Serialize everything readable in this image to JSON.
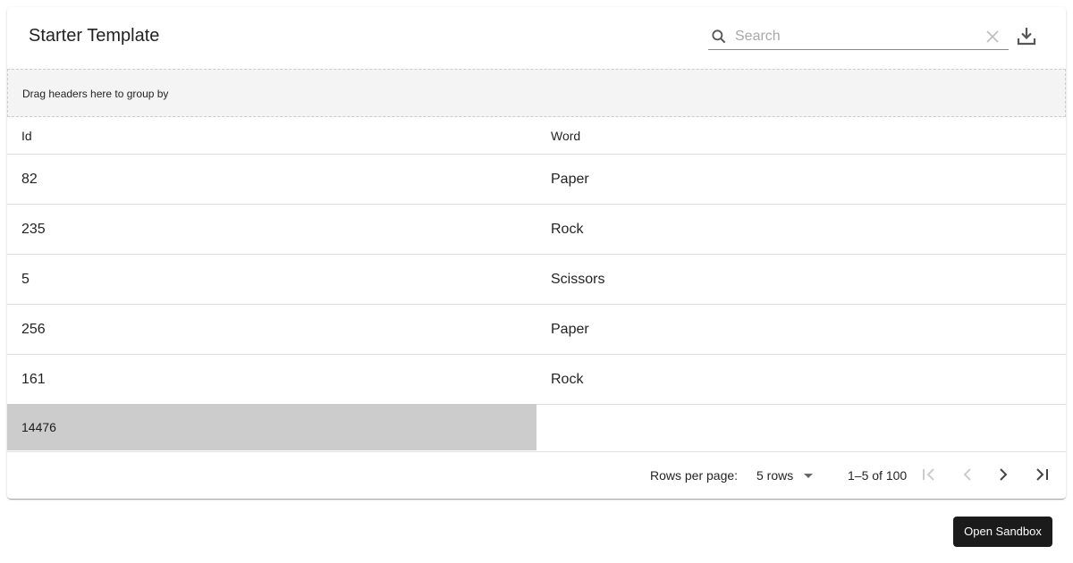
{
  "title": "Starter Template",
  "search": {
    "placeholder": "Search"
  },
  "group_hint": "Drag headers here to group by",
  "columns": [
    "Id",
    "Word"
  ],
  "rows": [
    {
      "id": "82",
      "word": "Paper"
    },
    {
      "id": "235",
      "word": "Rock"
    },
    {
      "id": "5",
      "word": "Scissors"
    },
    {
      "id": "256",
      "word": "Paper"
    },
    {
      "id": "161",
      "word": "Rock"
    }
  ],
  "aggregate": "14476",
  "pagination": {
    "rows_label": "Rows per page:",
    "rows_value": "5 rows",
    "range": "1–5 of 100"
  },
  "open_sandbox": "Open Sandbox"
}
